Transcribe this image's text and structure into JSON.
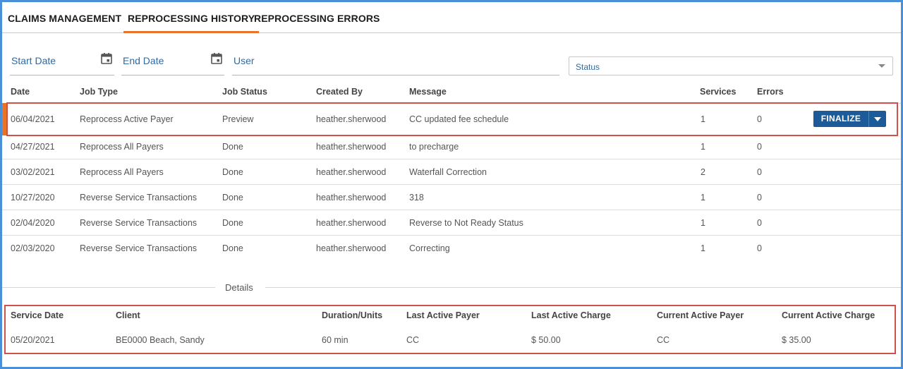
{
  "tabs": [
    {
      "label": "CLAIMS MANAGEMENT",
      "active": false
    },
    {
      "label": "REPROCESSING HISTORY",
      "active": true
    },
    {
      "label": "REPROCESSING ERRORS",
      "active": false
    }
  ],
  "filters": {
    "start_date": {
      "label": "Start Date",
      "icon": "calendar-icon"
    },
    "end_date": {
      "label": "End Date",
      "icon": "calendar-icon"
    },
    "user": {
      "label": "User"
    },
    "status": {
      "placeholder": "Status",
      "icon": "chevron-down-icon"
    }
  },
  "table": {
    "columns": [
      "Date",
      "Job Type",
      "Job Status",
      "Created By",
      "Message",
      "Services",
      "Errors"
    ],
    "rows": [
      {
        "date": "06/04/2021",
        "job_type": "Reprocess Active Payer",
        "job_status": "Preview",
        "created_by": "heather.sherwood",
        "message": "CC updated fee schedule",
        "services": "1",
        "errors": "0",
        "selected": true
      },
      {
        "date": "04/27/2021",
        "job_type": "Reprocess All Payers",
        "job_status": "Done",
        "created_by": "heather.sherwood",
        "message": "to precharge",
        "services": "1",
        "errors": "0"
      },
      {
        "date": "03/02/2021",
        "job_type": "Reprocess All Payers",
        "job_status": "Done",
        "created_by": "heather.sherwood",
        "message": "Waterfall Correction",
        "services": "2",
        "errors": "0"
      },
      {
        "date": "10/27/2020",
        "job_type": "Reverse Service Transactions",
        "job_status": "Done",
        "created_by": "heather.sherwood",
        "message": "318",
        "services": "1",
        "errors": "0"
      },
      {
        "date": "02/04/2020",
        "job_type": "Reverse Service Transactions",
        "job_status": "Done",
        "created_by": "heather.sherwood",
        "message": "Reverse to Not Ready Status",
        "services": "1",
        "errors": "0"
      },
      {
        "date": "02/03/2020",
        "job_type": "Reverse Service Transactions",
        "job_status": "Done",
        "created_by": "heather.sherwood",
        "message": "Correcting",
        "services": "1",
        "errors": "0"
      }
    ],
    "finalize_label": "FINALIZE"
  },
  "details": {
    "title": "Details",
    "columns": [
      "Service Date",
      "Client",
      "Duration/Units",
      "Last Active Payer",
      "Last Active Charge",
      "Current Active Payer",
      "Current Active Charge"
    ],
    "row": {
      "service_date": "05/20/2021",
      "client": "BE0000 Beach, Sandy",
      "duration": "60 min",
      "last_payer": "CC",
      "last_charge": "$ 50.00",
      "current_payer": "CC",
      "current_charge": "$ 35.00"
    }
  },
  "colors": {
    "accent": "#e8742a",
    "primary_button": "#1d5b98",
    "highlight_box": "#d0504a",
    "frame": "#4a90d9",
    "link_text": "#2f6aa3"
  }
}
